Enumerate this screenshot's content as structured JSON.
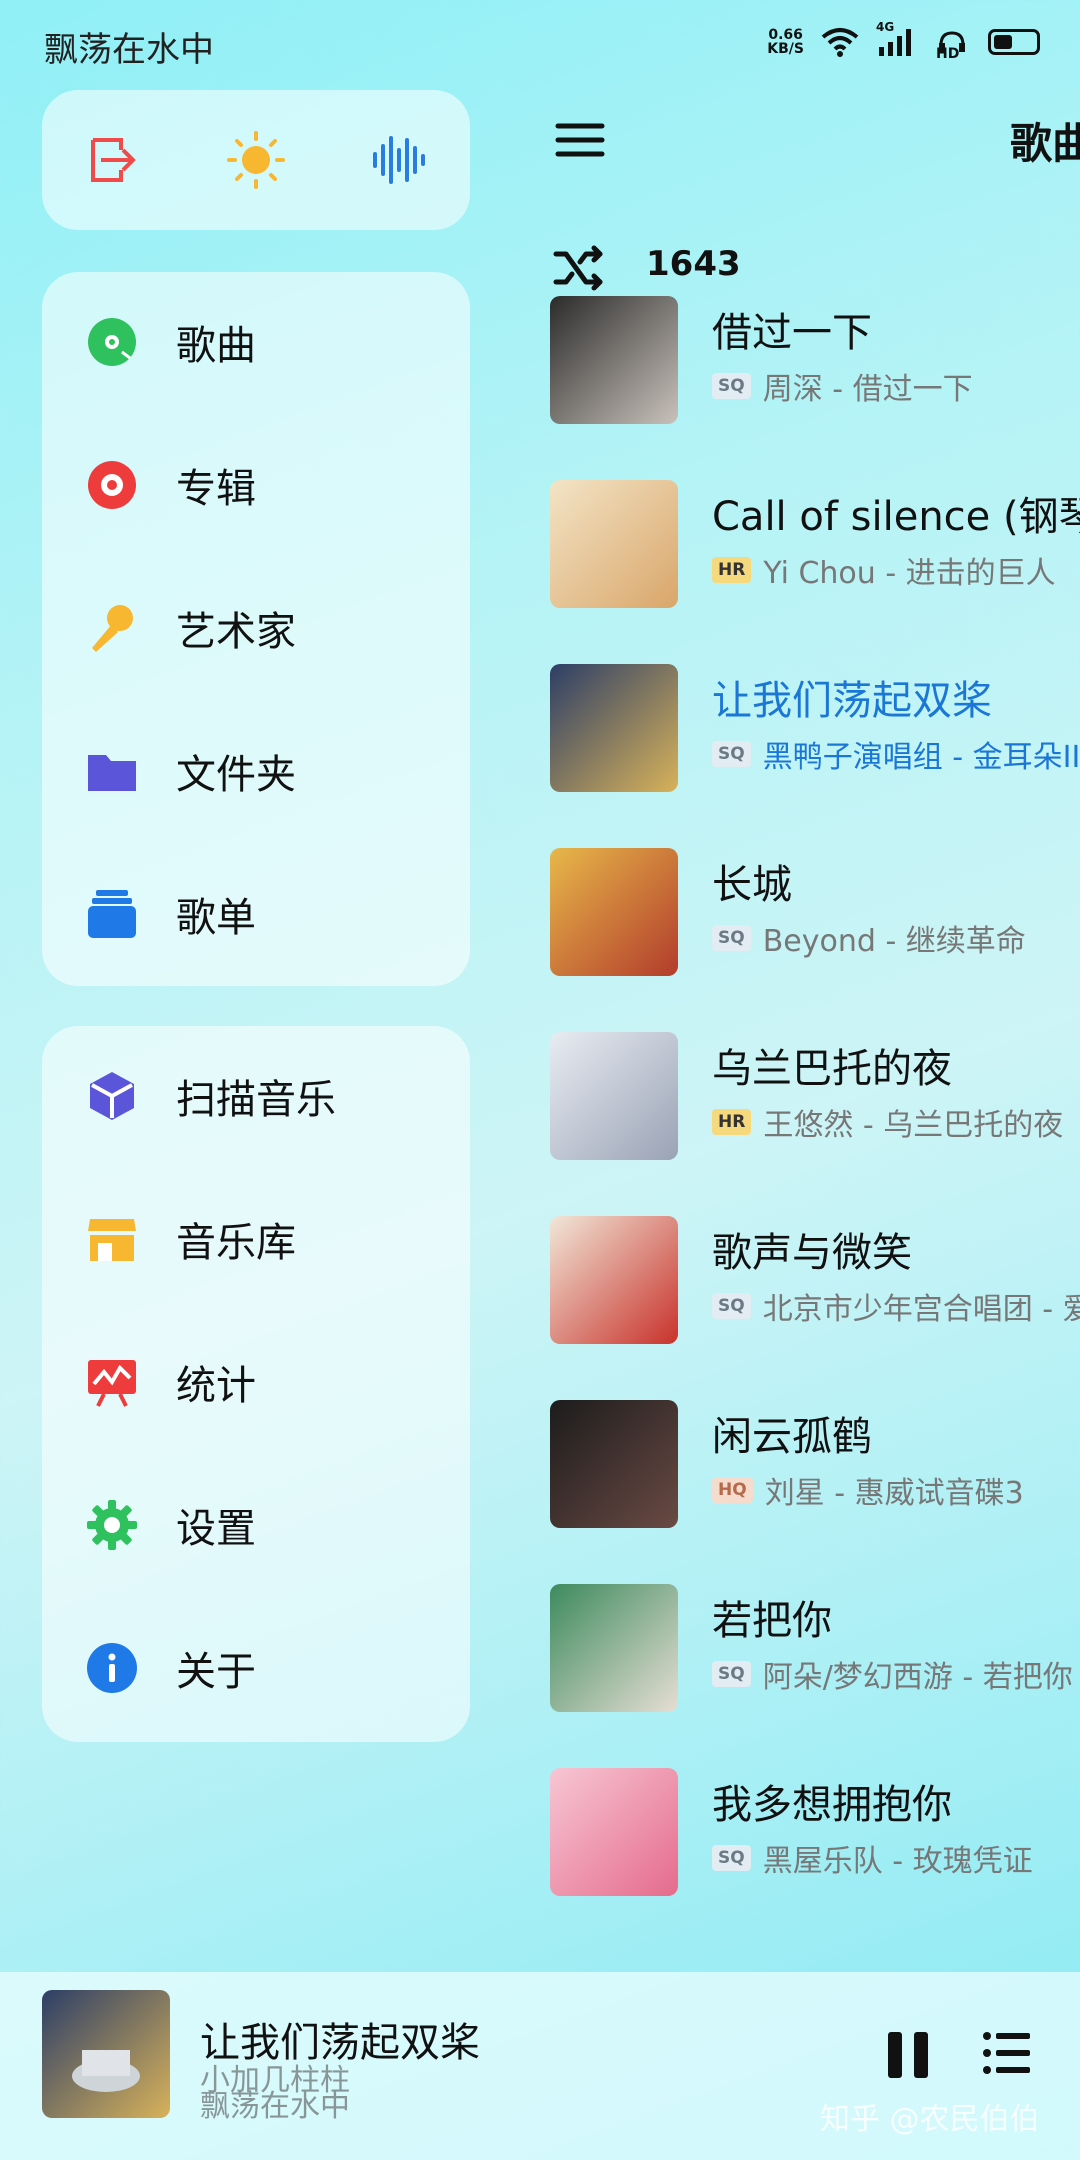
{
  "status_bar": {
    "title": "飘荡在水中",
    "net_speed_value": "0.66",
    "net_speed_unit": "KB/S",
    "network_label": "4G",
    "hd_label": "HD"
  },
  "drawer": {
    "top_buttons": [
      {
        "icon": "exit-icon",
        "color": "#f04a4a"
      },
      {
        "icon": "sun-icon",
        "color": "#f7b731"
      },
      {
        "icon": "waveform-icon",
        "color": "#2a7de0"
      }
    ],
    "primary_items": [
      {
        "label": "歌曲",
        "icon": "disc-icon",
        "color": "#2ec15e"
      },
      {
        "label": "专辑",
        "icon": "record-icon",
        "color": "#ee3b3b"
      },
      {
        "label": "艺术家",
        "icon": "microphone-icon",
        "color": "#f7b731"
      },
      {
        "label": "文件夹",
        "icon": "folder-icon",
        "color": "#5a55d9"
      },
      {
        "label": "歌单",
        "icon": "playlist-icon",
        "color": "#1f7ae8"
      }
    ],
    "secondary_items": [
      {
        "label": "扫描音乐",
        "icon": "scan-icon",
        "color": "#5a55d9"
      },
      {
        "label": "音乐库",
        "icon": "store-icon",
        "color": "#f7b731"
      },
      {
        "label": "统计",
        "icon": "stats-icon",
        "color": "#ee3b3b"
      },
      {
        "label": "设置",
        "icon": "gear-icon",
        "color": "#2ec15e"
      },
      {
        "label": "关于",
        "icon": "info-icon",
        "color": "#1f7ae8"
      }
    ]
  },
  "header": {
    "title": "歌曲",
    "song_count": "1643"
  },
  "songs": [
    {
      "title": "借过一下",
      "quality": "SQ",
      "subtitle": "周深 - 借过一下",
      "cover_colors": [
        "#2b2b2b",
        "#c9c2bb"
      ],
      "active": false
    },
    {
      "title": "Call of silence (钢琴版",
      "quality": "HR",
      "subtitle": "Yi Chou - 进击的巨人",
      "cover_colors": [
        "#f3e4c6",
        "#d9a66a"
      ],
      "active": false
    },
    {
      "title": "让我们荡起双桨",
      "quality": "SQ",
      "subtitle": "黑鸭子演唱组 - 金耳朵III",
      "cover_colors": [
        "#2c3e66",
        "#d8b25a"
      ],
      "active": true
    },
    {
      "title": "长城",
      "quality": "SQ",
      "subtitle": "Beyond - 继续革命",
      "cover_colors": [
        "#e7b84a",
        "#b23c2b"
      ],
      "active": false
    },
    {
      "title": "乌兰巴托的夜",
      "quality": "HR",
      "subtitle": "王悠然 - 乌兰巴托的夜",
      "cover_colors": [
        "#e8ecf2",
        "#9aa3b5"
      ],
      "active": false
    },
    {
      "title": "歌声与微笑",
      "quality": "SQ",
      "subtitle": "北京市少年宫合唱团 - 爱",
      "cover_colors": [
        "#f1e7d8",
        "#c8322b"
      ],
      "active": false
    },
    {
      "title": "闲云孤鹤",
      "quality": "HQ",
      "subtitle": "刘星 - 惠威试音碟3",
      "cover_colors": [
        "#1c1c1c",
        "#6a4a44"
      ],
      "active": false
    },
    {
      "title": "若把你",
      "quality": "SQ",
      "subtitle": "阿朵/梦幻西游 - 若把你",
      "cover_colors": [
        "#3d8a5e",
        "#e6ded3"
      ],
      "active": false
    },
    {
      "title": "我多想拥抱你",
      "quality": "SQ",
      "subtitle": "黑屋乐队 - 玫瑰凭证",
      "cover_colors": [
        "#f7c6d4",
        "#e56b8c"
      ],
      "active": false
    }
  ],
  "player": {
    "title": "让我们荡起双桨",
    "subtitle_line1": "小加几柱柱",
    "subtitle_line2": "飘荡在水中",
    "watermark": "知乎 @农民伯伯"
  }
}
